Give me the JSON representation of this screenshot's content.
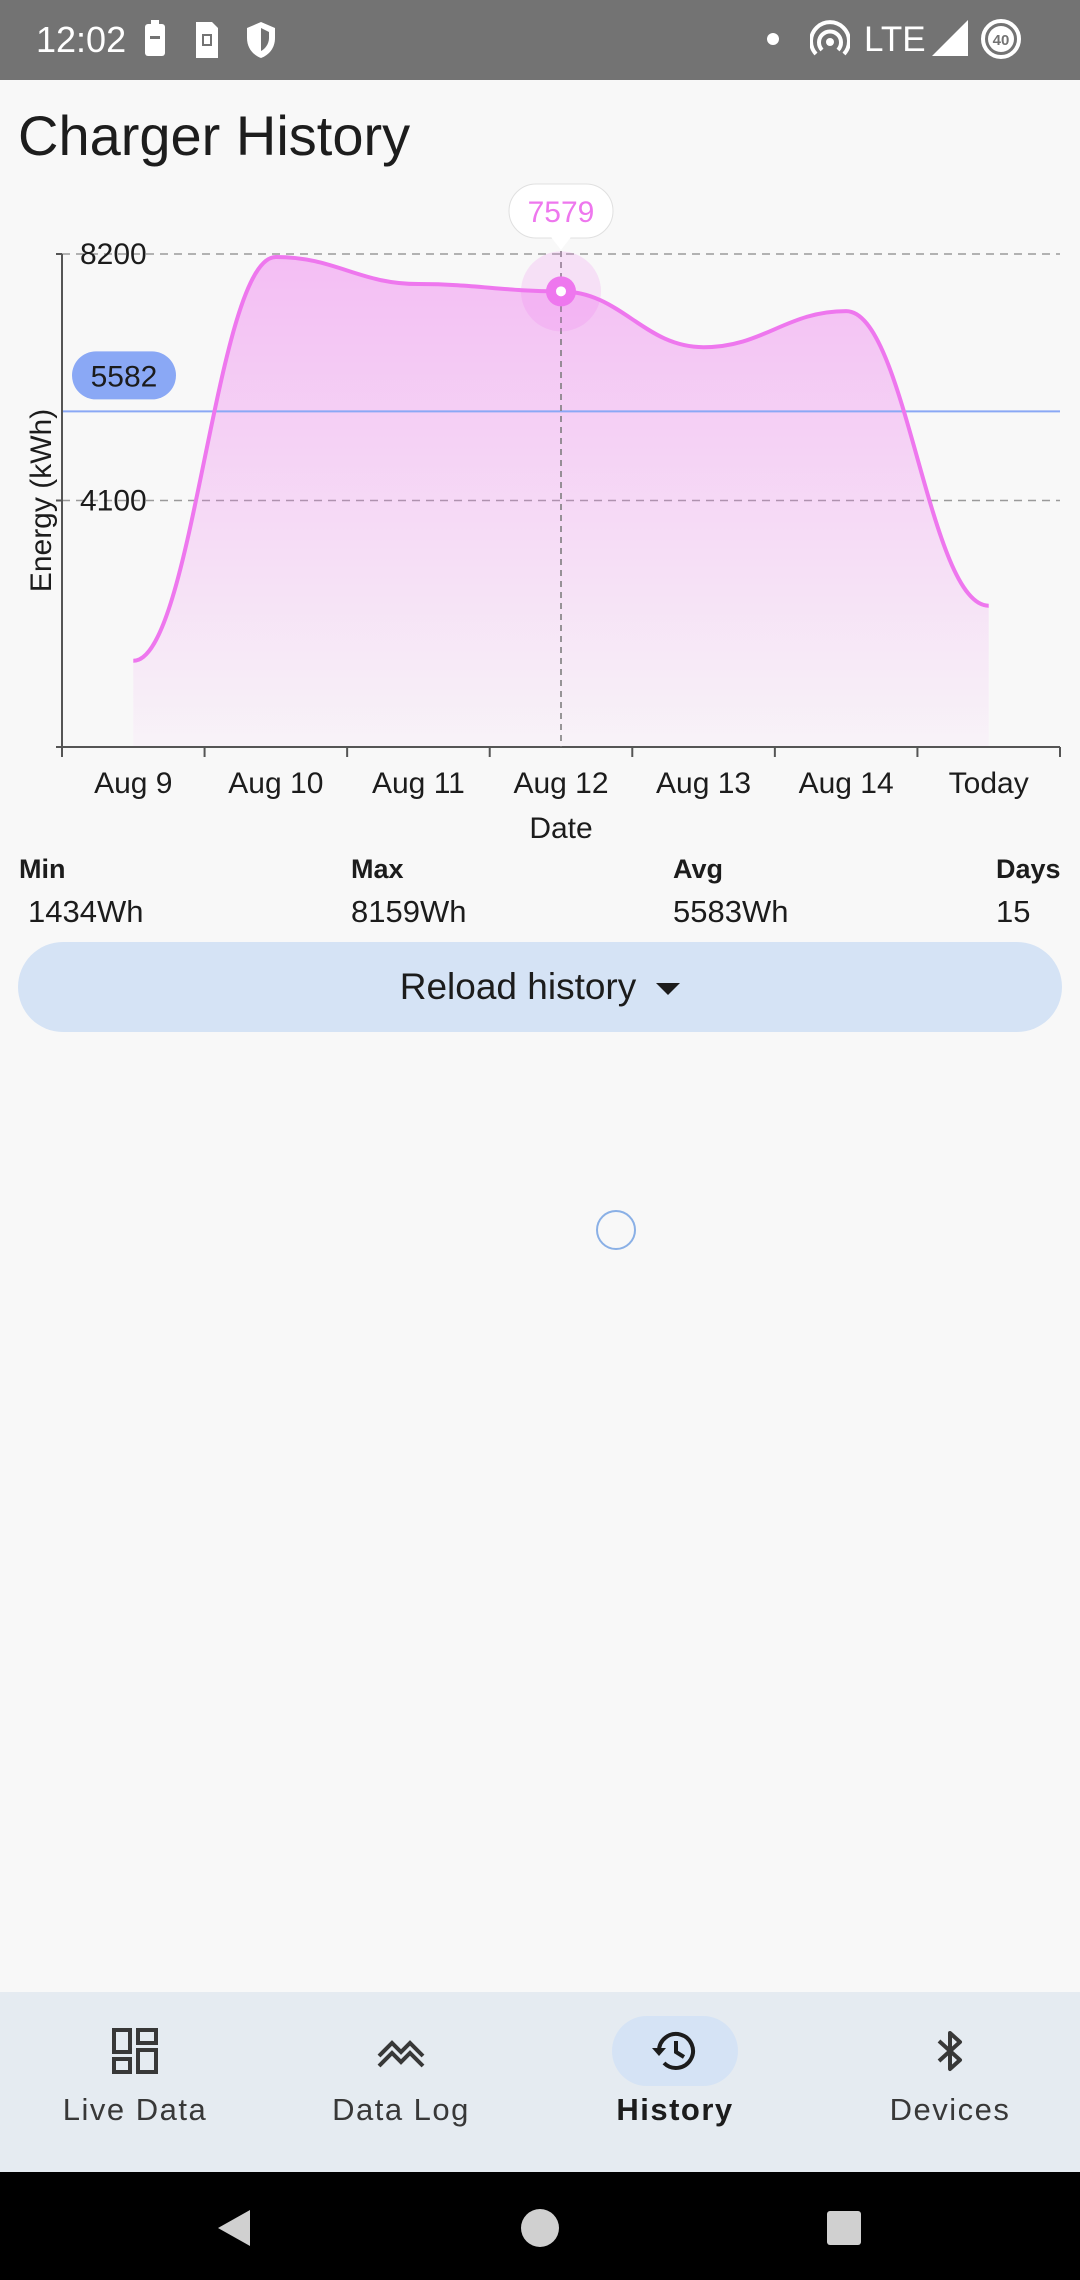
{
  "status_bar": {
    "time": "12:02",
    "network": "LTE",
    "icons": [
      "battery-saver-icon",
      "sim-card-icon",
      "shield-icon",
      "dot-icon",
      "hotspot-icon",
      "signal-icon",
      "battery-icon"
    ],
    "battery_level": "40"
  },
  "page": {
    "title": "Charger History"
  },
  "chart_data": {
    "type": "area",
    "x_categories": [
      "Aug 9",
      "Aug 10",
      "Aug 11",
      "Aug 12",
      "Aug 13",
      "Aug 14",
      "Today"
    ],
    "series": [
      {
        "values": [
          1434,
          8150,
          7700,
          7579,
          6650,
          7250,
          2350
        ],
        "color": "#ee77ee"
      }
    ],
    "xlabel": "Date",
    "ylabel": "Energy (kWh)",
    "y_ticks": [
      4100,
      8200
    ],
    "y_tick_labels": [
      "4100",
      "8200"
    ],
    "ylim": [
      0,
      8200
    ],
    "grid": "dashed horizontal",
    "average_line": {
      "value": 5582,
      "label": "5582",
      "color": "#8aa8f5"
    },
    "selected_point": {
      "category": "Aug 12",
      "value": 7579,
      "label": "7579"
    }
  },
  "stats": {
    "min": {
      "label": "Min",
      "value": "1434Wh"
    },
    "max": {
      "label": "Max",
      "value": "8159Wh"
    },
    "avg": {
      "label": "Avg",
      "value": "5583Wh"
    },
    "days": {
      "label": "Days",
      "value": "15"
    }
  },
  "actions": {
    "reload_label": "Reload history"
  },
  "bottom_nav": {
    "items": [
      {
        "label": "Live Data",
        "icon": "dashboard-icon",
        "active": false
      },
      {
        "label": "Data Log",
        "icon": "trending-icon",
        "active": false
      },
      {
        "label": "History",
        "icon": "history-icon",
        "active": true
      },
      {
        "label": "Devices",
        "icon": "bluetooth-icon",
        "active": false
      }
    ]
  },
  "colors": {
    "accent": "#ee77ee",
    "avg_line": "#8aa8f5",
    "nav_active": "#d5e3f5",
    "button": "#d5e3f5"
  }
}
